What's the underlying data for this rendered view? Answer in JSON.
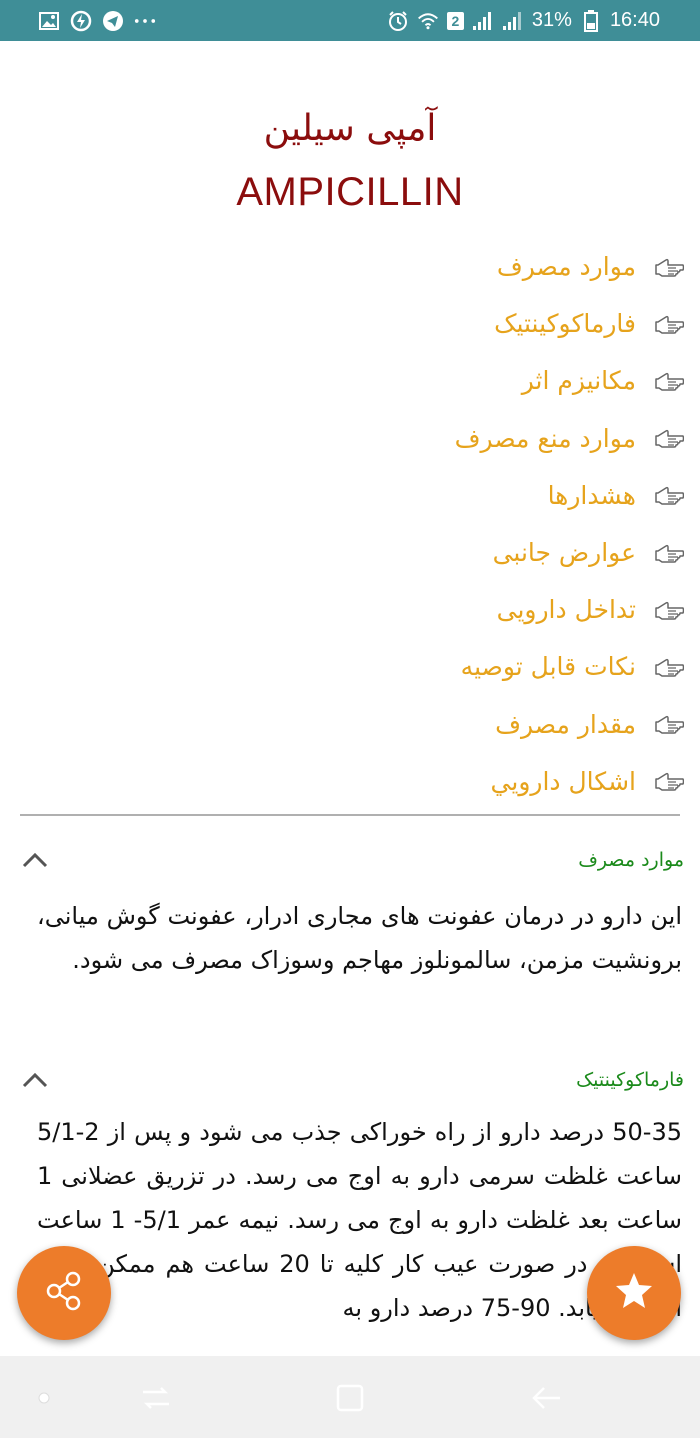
{
  "status_bar": {
    "battery_percent": "31%",
    "time": "16:40",
    "sim_badge": "2",
    "left_icons": [
      "gallery-icon",
      "data-saver-icon",
      "telegram-icon",
      "more-notifications-icon"
    ],
    "right_icons": [
      "alarm-icon",
      "wifi-icon",
      "signal-icon",
      "signal-icon",
      "battery-icon"
    ]
  },
  "title": {
    "persian": "آمپی سیلین",
    "english": "AMPICILLIN"
  },
  "toc": {
    "items": [
      {
        "label": "موارد مصرف"
      },
      {
        "label": "فارماکوکینتیک"
      },
      {
        "label": "مکانیزم اثر"
      },
      {
        "label": "موارد منع مصرف"
      },
      {
        "label": "هشدارها"
      },
      {
        "label": "عوارض جانبی"
      },
      {
        "label": "تداخل دارویی"
      },
      {
        "label": "نکات قابل توصیه"
      },
      {
        "label": "مقدار مصرف"
      },
      {
        "label": "اشکال دارويي"
      }
    ]
  },
  "sections": [
    {
      "header": "موارد مصرف",
      "body": "این دارو در درمان عفونت های مجاری ادرار، عفونت گوش میانی، برونشیت مزمن، سالمونلوز مهاجم وسوزاک مصرف می شود."
    },
    {
      "header": "فارماکوکینتیک",
      "body": "50-35 درصد دارو از راه خوراکی جذب می شود و پس از 2-5/1 ساعت غلظت سرمی دارو به اوج می رسد. در تزریق عضلانی 1 ساعت بعد غلظت دارو به اوج می رسد. نیمه عمر 5/1- 1 ساعت است که در صورت عیب کار کلیه تا 20 ساعت هم ممکن است افزایش یابد. 90-75 درصد دارو به"
    }
  ],
  "colors": {
    "status_bar": "#3f8e97",
    "title": "#8b0d0d",
    "toc_link": "#e6a31c",
    "section_header": "#1b8a1b",
    "fab": "#ed7c2a"
  },
  "fabs": {
    "share_icon": "share-icon",
    "favorite_icon": "star-icon"
  },
  "nav_bar": {
    "icons": [
      "dot-icon",
      "recent-apps-icon",
      "home-icon",
      "back-icon"
    ]
  }
}
